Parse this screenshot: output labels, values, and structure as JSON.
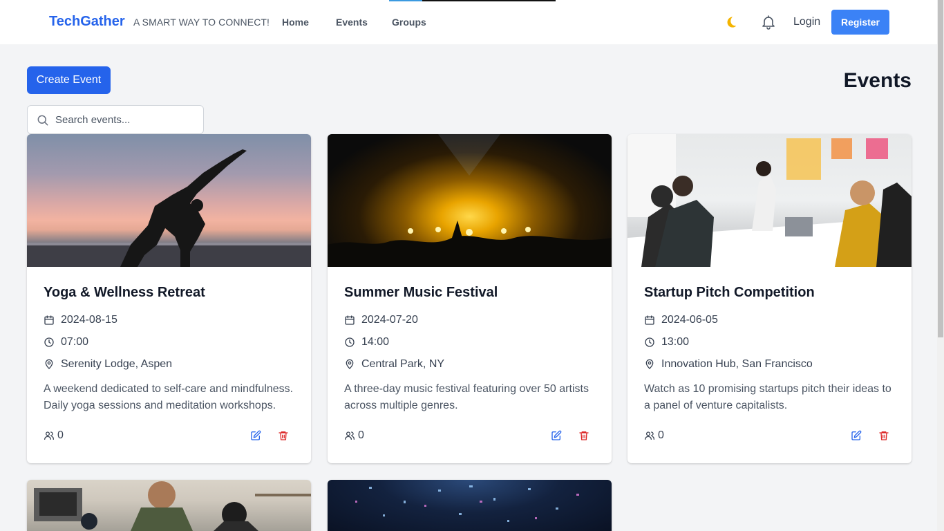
{
  "header": {
    "brand": "TechGather",
    "tagline": "A SMART WAY TO CONNECT!",
    "nav": [
      {
        "label": "Home"
      },
      {
        "label": "Events"
      },
      {
        "label": "Groups"
      }
    ],
    "login_label": "Login",
    "register_label": "Register"
  },
  "toolbar": {
    "create_label": "Create Event",
    "page_title": "Events",
    "search_placeholder": "Search events..."
  },
  "events": [
    {
      "title": "Yoga & Wellness Retreat",
      "date": "2024-08-15",
      "time": "07:00",
      "location": "Serenity Lodge, Aspen",
      "description": "A weekend dedicated to self-care and mindfulness. Daily yoga sessions and meditation workshops.",
      "attendees": "0"
    },
    {
      "title": "Summer Music Festival",
      "date": "2024-07-20",
      "time": "14:00",
      "location": "Central Park, NY",
      "description": "A three-day music festival featuring over 50 artists across multiple genres.",
      "attendees": "0"
    },
    {
      "title": "Startup Pitch Competition",
      "date": "2024-06-05",
      "time": "13:00",
      "location": "Innovation Hub, San Francisco",
      "description": "Watch as 10 promising startups pitch their ideas to a panel of venture capitalists.",
      "attendees": "0"
    }
  ],
  "colors": {
    "brand": "#2563eb",
    "register": "#3b82f6",
    "edit_icon": "#2563eb",
    "delete_icon": "#dc2626",
    "background": "#f3f4f6"
  }
}
